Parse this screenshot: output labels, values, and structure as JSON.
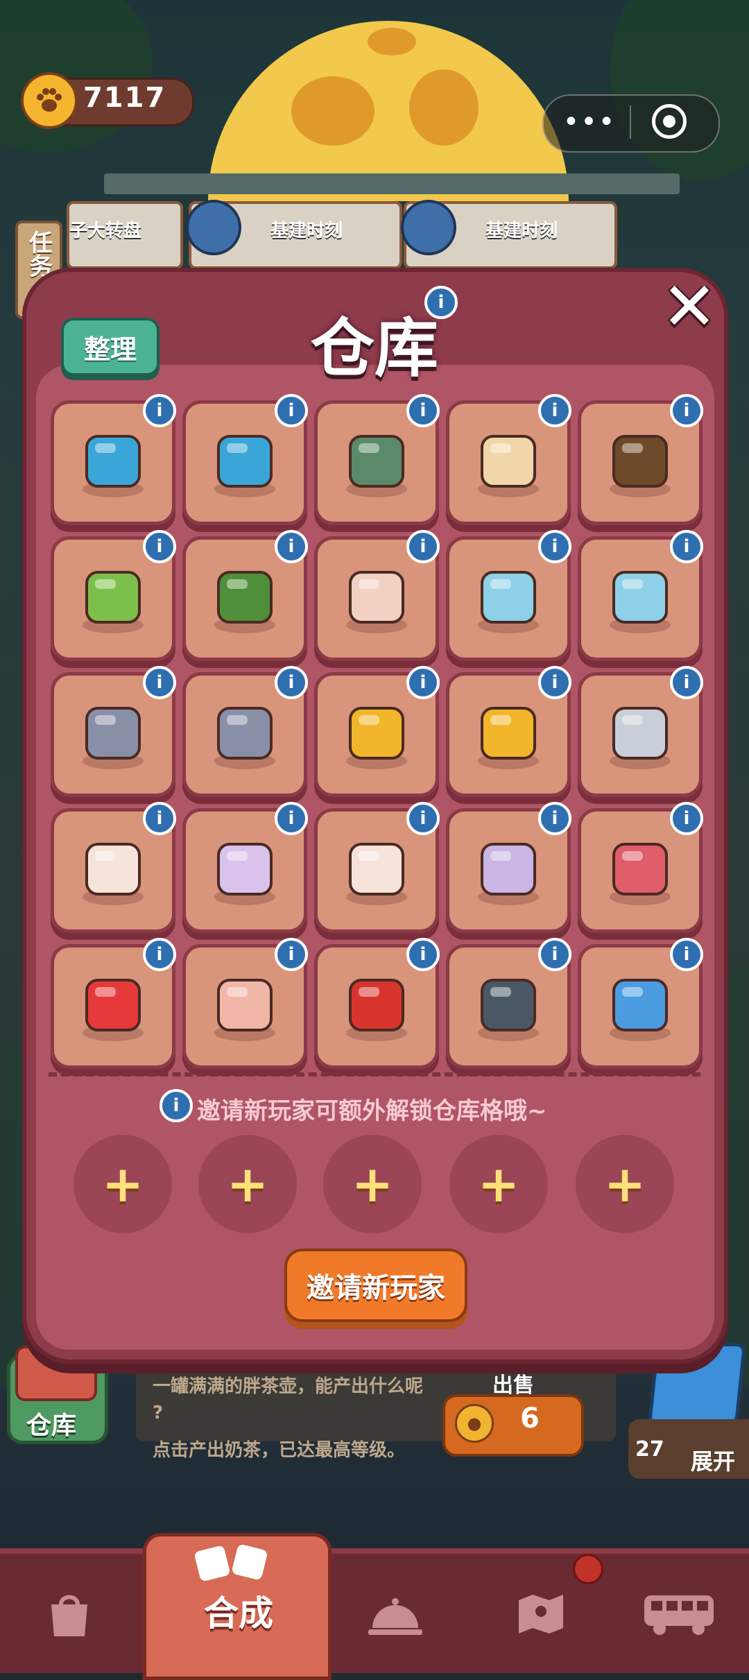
{
  "top_bar": {
    "coins": "7117",
    "more_icon": "ellipsis-icon",
    "close_icon": "target-icon"
  },
  "background": {
    "side_task_label": "任务",
    "wheel_partial_label": "子大转盘",
    "card1_label": "基建时刻",
    "card2_label": "基建时刻"
  },
  "warehouse": {
    "title": "仓库",
    "sort_label": "整理",
    "info_glyph": "i",
    "close_glyph": "✕",
    "items": [
      {
        "name": "energy-box"
      },
      {
        "name": "energy-box"
      },
      {
        "name": "hand-truck"
      },
      {
        "name": "dumpling-bowl"
      },
      {
        "name": "sauce-bottle"
      },
      {
        "name": "herb-cutting-board"
      },
      {
        "name": "seaweed-board"
      },
      {
        "name": "shrimp-napkin"
      },
      {
        "name": "photo-puzzle"
      },
      {
        "name": "photo-puzzle"
      },
      {
        "name": "fish-statue"
      },
      {
        "name": "fish-statue"
      },
      {
        "name": "gold-medal"
      },
      {
        "name": "gold-medal"
      },
      {
        "name": "whistle"
      },
      {
        "name": "glass-jar"
      },
      {
        "name": "flower-orb"
      },
      {
        "name": "glass-jar"
      },
      {
        "name": "orb-pendant"
      },
      {
        "name": "music-box"
      },
      {
        "name": "double-happiness-sign"
      },
      {
        "name": "folded-paper"
      },
      {
        "name": "red-helmet"
      },
      {
        "name": "swim-goggles"
      },
      {
        "name": "blue-fish"
      }
    ],
    "invite_note": "邀请新玩家可额外解锁仓库格哦~",
    "locked_slot_glyph": "+",
    "invite_button": "邀请新玩家"
  },
  "info_panel": {
    "line1": "一罐满满的胖茶壶，能产出什么呢",
    "line2": "?",
    "line3": "点击产出奶茶，已达最高等级。",
    "sell_label": "出售",
    "sell_price": "6"
  },
  "side": {
    "warehouse_label": "仓库",
    "expand_count": "27",
    "expand_label": "展开"
  },
  "tabbar": {
    "merge_label": "合成",
    "tabs": [
      "shop-bag-icon",
      "merge-icon",
      "service-bell-icon",
      "map-icon",
      "bus-icon"
    ]
  },
  "colors": {
    "modal": "#8e3b4b",
    "cell": "#d8957b",
    "accent_orange": "#f07a2a",
    "sort_green": "#4bb394"
  }
}
